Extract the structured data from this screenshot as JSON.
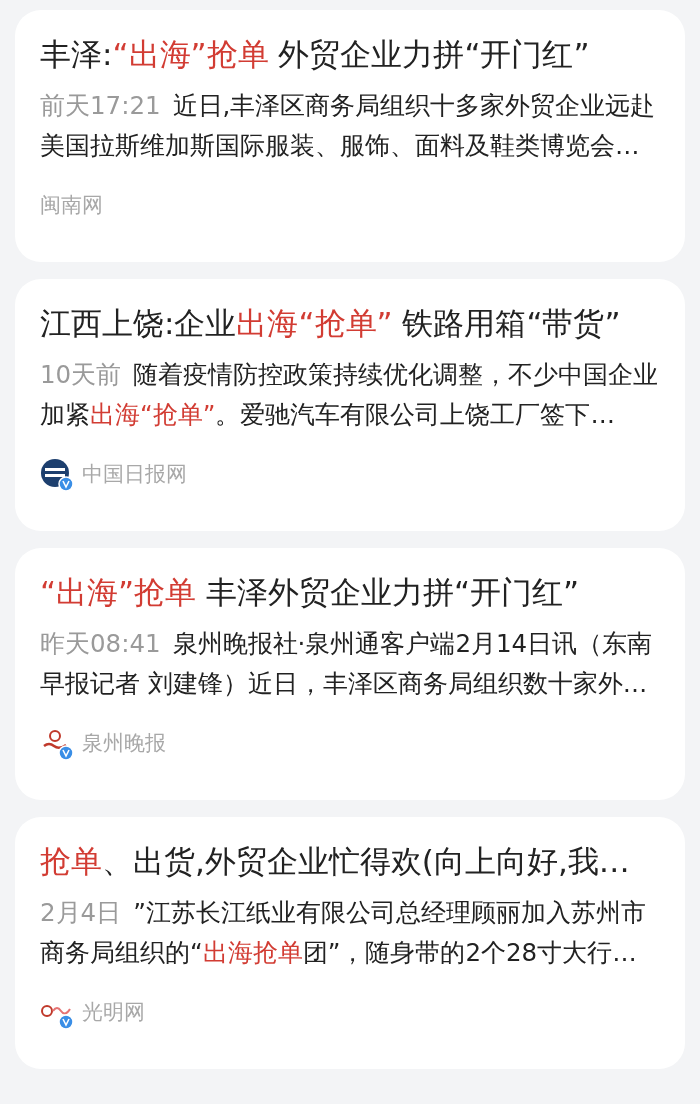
{
  "articles": [
    {
      "title": [
        {
          "text": "丰泽:",
          "highlight": false
        },
        {
          "text": "“出海”抢单",
          "highlight": true
        },
        {
          "text": " 外贸企业力拼“开门红”",
          "highlight": false
        }
      ],
      "time": "前天17:21",
      "summary": [
        {
          "text": "近日,丰泽区商务局组织十多家外贸企业远赴美国拉斯维加斯国际服装、服饰、面料及鞋类博览会…",
          "highlight": false
        }
      ],
      "source": {
        "name": "闽南网",
        "kind": "none"
      }
    },
    {
      "title": [
        {
          "text": "江西上饶:企业",
          "highlight": false
        },
        {
          "text": "出海“抢单”",
          "highlight": true
        },
        {
          "text": " 铁路用箱“带货”",
          "highlight": false
        }
      ],
      "time": "10天前",
      "summary": [
        {
          "text": "随着疫情防控政策持续优化调整，不少中国企业加紧",
          "highlight": false
        },
        {
          "text": "出海“抢单”",
          "highlight": true
        },
        {
          "text": "。爱驰汽车有限公司上饶工厂签下…",
          "highlight": false
        }
      ],
      "source": {
        "name": "中国日报网",
        "kind": "globe"
      }
    },
    {
      "title": [
        {
          "text": "“出海”抢单",
          "highlight": true
        },
        {
          "text": " 丰泽外贸企业力拼“开门红”",
          "highlight": false
        }
      ],
      "time": "昨天08:41",
      "summary": [
        {
          "text": "泉州晚报社·泉州通客户端2月14日讯（东南早报记者 刘建锋）近日，丰泽区商务局组织数十家外…",
          "highlight": false
        }
      ],
      "source": {
        "name": "泉州晚报",
        "kind": "emblem"
      }
    },
    {
      "title": [
        {
          "text": "抢单",
          "highlight": true
        },
        {
          "text": "、出货,外贸企业忙得欢(向上向好,我…",
          "highlight": false
        }
      ],
      "time": "2月4日",
      "summary": [
        {
          "text": "”江苏长江纸业有限公司总经理顾丽加入苏州市商务局组织的“",
          "highlight": false
        },
        {
          "text": "出海抢单",
          "highlight": true
        },
        {
          "text": "团”，随身带的2个28寸大行…",
          "highlight": false
        }
      ],
      "source": {
        "name": "光明网",
        "kind": "wordmark"
      }
    }
  ]
}
